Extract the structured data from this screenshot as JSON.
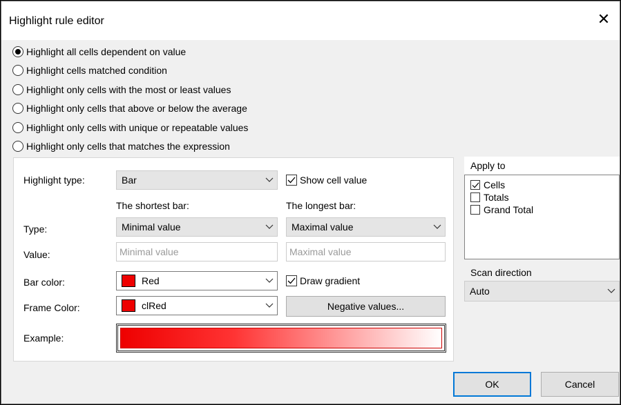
{
  "title": "Highlight rule editor",
  "close_icon": "close-icon",
  "modes": [
    {
      "label": "Highlight all cells dependent on value",
      "checked": true
    },
    {
      "label": "Highlight cells matched condition",
      "checked": false
    },
    {
      "label": "Highlight only cells with the most or least values",
      "checked": false
    },
    {
      "label": "Highlight only cells that above or below the average",
      "checked": false
    },
    {
      "label": "Highlight only cells with unique or repeatable values",
      "checked": false
    },
    {
      "label": "Highlight only cells that matches the expression",
      "checked": false
    }
  ],
  "settings": {
    "highlight_type_label": "Highlight type:",
    "highlight_type_value": "Bar",
    "show_cell_value_label": "Show cell value",
    "show_cell_value_checked": true,
    "shortest_bar_label": "The shortest bar:",
    "longest_bar_label": "The longest bar:",
    "type_label": "Type:",
    "type_short_value": "Minimal value",
    "type_long_value": "Maximal value",
    "value_label": "Value:",
    "value_short_placeholder": "Minimal value",
    "value_long_placeholder": "Maximal value",
    "bar_color_label": "Bar color:",
    "bar_color_value": "Red",
    "bar_color_hex": "#ee0000",
    "draw_gradient_label": "Draw gradient",
    "draw_gradient_checked": true,
    "frame_color_label": "Frame Color:",
    "frame_color_value": "clRed",
    "frame_color_hex": "#ee0000",
    "negative_values_button": "Negative values...",
    "example_label": "Example:"
  },
  "apply_to": {
    "header": "Apply to",
    "items": [
      {
        "label": "Cells",
        "checked": true
      },
      {
        "label": "Totals",
        "checked": false
      },
      {
        "label": "Grand Total",
        "checked": false
      }
    ]
  },
  "scan_direction": {
    "label": "Scan direction",
    "value": "Auto"
  },
  "buttons": {
    "ok": "OK",
    "cancel": "Cancel"
  },
  "colors": {
    "accent": "#0078d7",
    "bar": "#ee0000"
  }
}
